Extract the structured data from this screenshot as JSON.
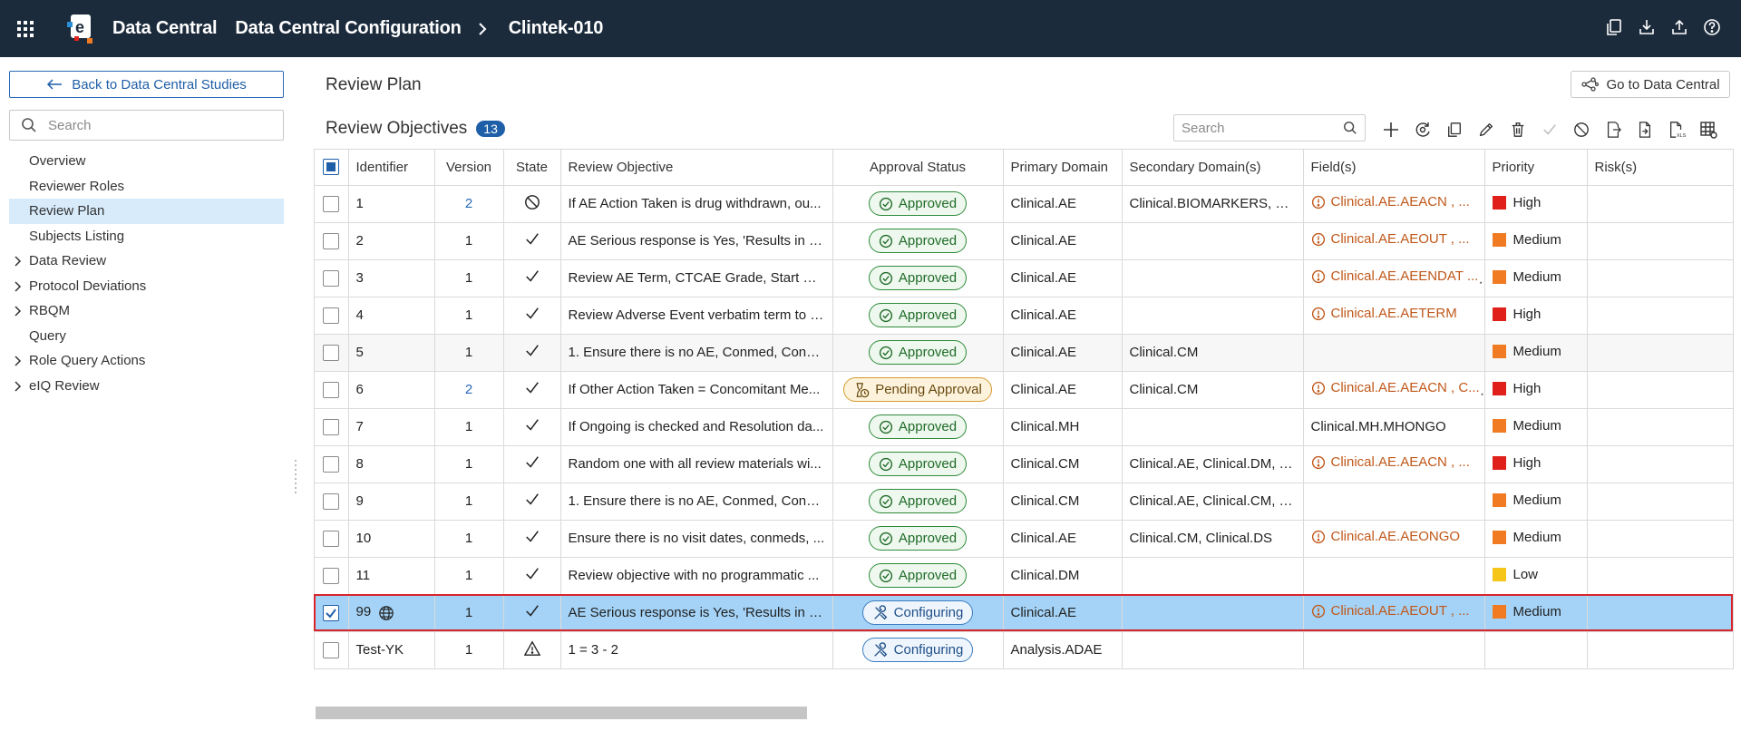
{
  "header": {
    "app_name": "Data Central",
    "breadcrumb": [
      "Data Central Configuration",
      "Clintek-010"
    ]
  },
  "sidebar": {
    "back_label": "Back to Data Central Studies",
    "search_placeholder": "Search",
    "items": [
      {
        "label": "Overview",
        "expandable": false
      },
      {
        "label": "Reviewer Roles",
        "expandable": false
      },
      {
        "label": "Review Plan",
        "expandable": false,
        "active": true
      },
      {
        "label": "Subjects Listing",
        "expandable": false
      },
      {
        "label": "Data Review",
        "expandable": true
      },
      {
        "label": "Protocol Deviations",
        "expandable": true
      },
      {
        "label": "RBQM",
        "expandable": true
      },
      {
        "label": "Query",
        "expandable": false
      },
      {
        "label": "Role Query Actions",
        "expandable": true
      },
      {
        "label": "eIQ Review",
        "expandable": true
      }
    ]
  },
  "main": {
    "page_title": "Review Plan",
    "goto_label": "Go to Data Central",
    "section_title": "Review Objectives",
    "count": "13",
    "search_placeholder": "Search",
    "columns": [
      "Identifier",
      "Version",
      "State",
      "Review Objective",
      "Approval Status",
      "Primary Domain",
      "Secondary Domain(s)",
      "Field(s)",
      "Priority",
      "Risk(s)"
    ],
    "rows": [
      {
        "id": "1",
        "version": "2",
        "version_link": true,
        "state": "blocked",
        "objective": "If AE Action Taken is drug withdrawn, ou...",
        "status": "Approved",
        "status_kind": "approved",
        "primary": "Clinical.AE",
        "secondary": "Clinical.BIOMARKERS, Cli...",
        "fields": "Clinical.AE.AEACN , ...",
        "fields_warn": true,
        "priority": "High"
      },
      {
        "id": "2",
        "version": "1",
        "state": "check",
        "objective": "AE Serious response is Yes, 'Results in D...",
        "status": "Approved",
        "status_kind": "approved",
        "primary": "Clinical.AE",
        "secondary": "",
        "fields": "Clinical.AE.AEOUT , ...",
        "fields_warn": true,
        "priority": "Medium"
      },
      {
        "id": "3",
        "version": "1",
        "state": "check",
        "objective": "Review AE Term, CTCAE Grade, Start Dat...",
        "status": "Approved",
        "status_kind": "approved",
        "primary": "Clinical.AE",
        "secondary": "",
        "fields": "Clinical.AE.AEENDAT ...",
        "fields_warn": true,
        "priority": "Medium"
      },
      {
        "id": "4",
        "version": "1",
        "state": "check",
        "objective": "Review Adverse Event verbatim term to e...",
        "status": "Approved",
        "status_kind": "approved",
        "primary": "Clinical.AE",
        "secondary": "",
        "fields": "Clinical.AE.AETERM",
        "fields_warn": true,
        "priority": "High"
      },
      {
        "id": "5",
        "version": "1",
        "state": "check",
        "objective": "1. Ensure there is no AE, Conmed, Conm...",
        "status": "Approved",
        "status_kind": "approved",
        "primary": "Clinical.AE",
        "secondary": "Clinical.CM",
        "fields": "",
        "fields_warn": false,
        "priority": "Medium",
        "alt": true
      },
      {
        "id": "6",
        "version": "2",
        "version_link": true,
        "state": "check",
        "objective": "If Other Action Taken = Concomitant Me...",
        "status": "Pending Approval",
        "status_kind": "pending",
        "primary": "Clinical.AE",
        "secondary": "Clinical.CM",
        "fields": "Clinical.AE.AEACN , C...",
        "fields_warn": true,
        "priority": "High"
      },
      {
        "id": "7",
        "version": "1",
        "state": "check",
        "objective": "If Ongoing is checked and Resolution da...",
        "status": "Approved",
        "status_kind": "approved",
        "primary": "Clinical.MH",
        "secondary": "",
        "fields": "Clinical.MH.MHONGO",
        "fields_warn": false,
        "priority": "Medium"
      },
      {
        "id": "8",
        "version": "1",
        "state": "check",
        "objective": "Random one with all review materials wi...",
        "status": "Approved",
        "status_kind": "approved",
        "primary": "Clinical.CM",
        "secondary": "Clinical.AE, Clinical.DM, C...",
        "fields": "Clinical.AE.AEACN , ...",
        "fields_warn": true,
        "priority": "High"
      },
      {
        "id": "9",
        "version": "1",
        "state": "check",
        "objective": "1. Ensure there is no AE, Conmed, Conm...",
        "status": "Approved",
        "status_kind": "approved",
        "primary": "Clinical.CM",
        "secondary": "Clinical.AE, Clinical.CM, C...",
        "fields": "",
        "fields_warn": false,
        "priority": "Medium"
      },
      {
        "id": "10",
        "version": "1",
        "state": "check",
        "objective": "Ensure there is no visit dates, conmeds, ...",
        "status": "Approved",
        "status_kind": "approved",
        "primary": "Clinical.AE",
        "secondary": "Clinical.CM, Clinical.DS",
        "fields": "Clinical.AE.AEONGO",
        "fields_warn": true,
        "priority": "Medium"
      },
      {
        "id": "11",
        "version": "1",
        "state": "check",
        "objective": "Review objective with no programmatic ...",
        "status": "Approved",
        "status_kind": "approved",
        "primary": "Clinical.DM",
        "secondary": "",
        "fields": "",
        "fields_warn": false,
        "priority": "Low"
      },
      {
        "id": "99",
        "id_globe": true,
        "version": "1",
        "state": "check",
        "objective": "AE Serious response is Yes, 'Results in D...",
        "status": "Configuring",
        "status_kind": "config",
        "primary": "Clinical.AE",
        "secondary": "",
        "fields": "Clinical.AE.AEOUT , ...",
        "fields_warn": true,
        "priority": "Medium",
        "selected": true
      },
      {
        "id": "Test-YK",
        "version": "1",
        "state": "warn",
        "objective": "1 = 3 - 2",
        "status": "Configuring",
        "status_kind": "config",
        "primary": "Analysis.ADAE",
        "secondary": "",
        "fields": "",
        "fields_warn": false,
        "priority": ""
      }
    ]
  },
  "colors": {
    "header_bg": "#1c2b3c",
    "accent": "#1f5fa8",
    "priority_high": "#e0201b",
    "priority_medium": "#f07b22",
    "priority_low": "#f5c518",
    "selected_row": "#a4d3f7",
    "selected_outline": "#d7262c"
  }
}
